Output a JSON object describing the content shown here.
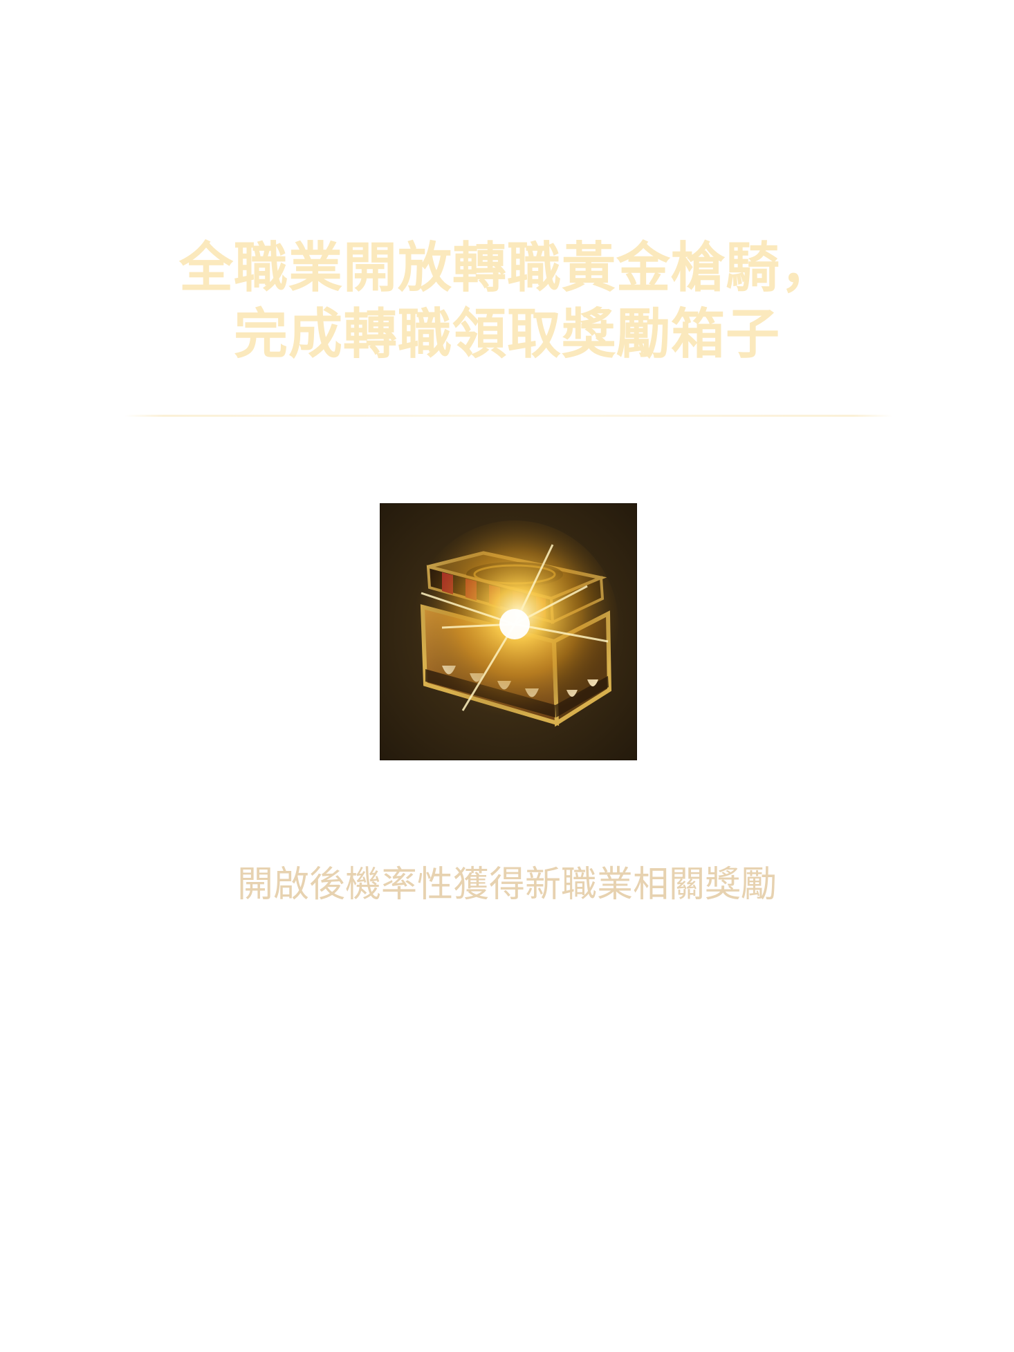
{
  "header": {
    "title_line1": "全職業開放轉職黃金槍騎，",
    "title_line2": "完成轉職領取獎勵箱子"
  },
  "reward": {
    "icon": "treasure-chest-icon",
    "name": "",
    "description": "開啟後機率性獲得新職業相關獎勵"
  },
  "colors": {
    "title": "#fbe9bd",
    "description": "#e7d2b0",
    "background": "#ffffff"
  }
}
